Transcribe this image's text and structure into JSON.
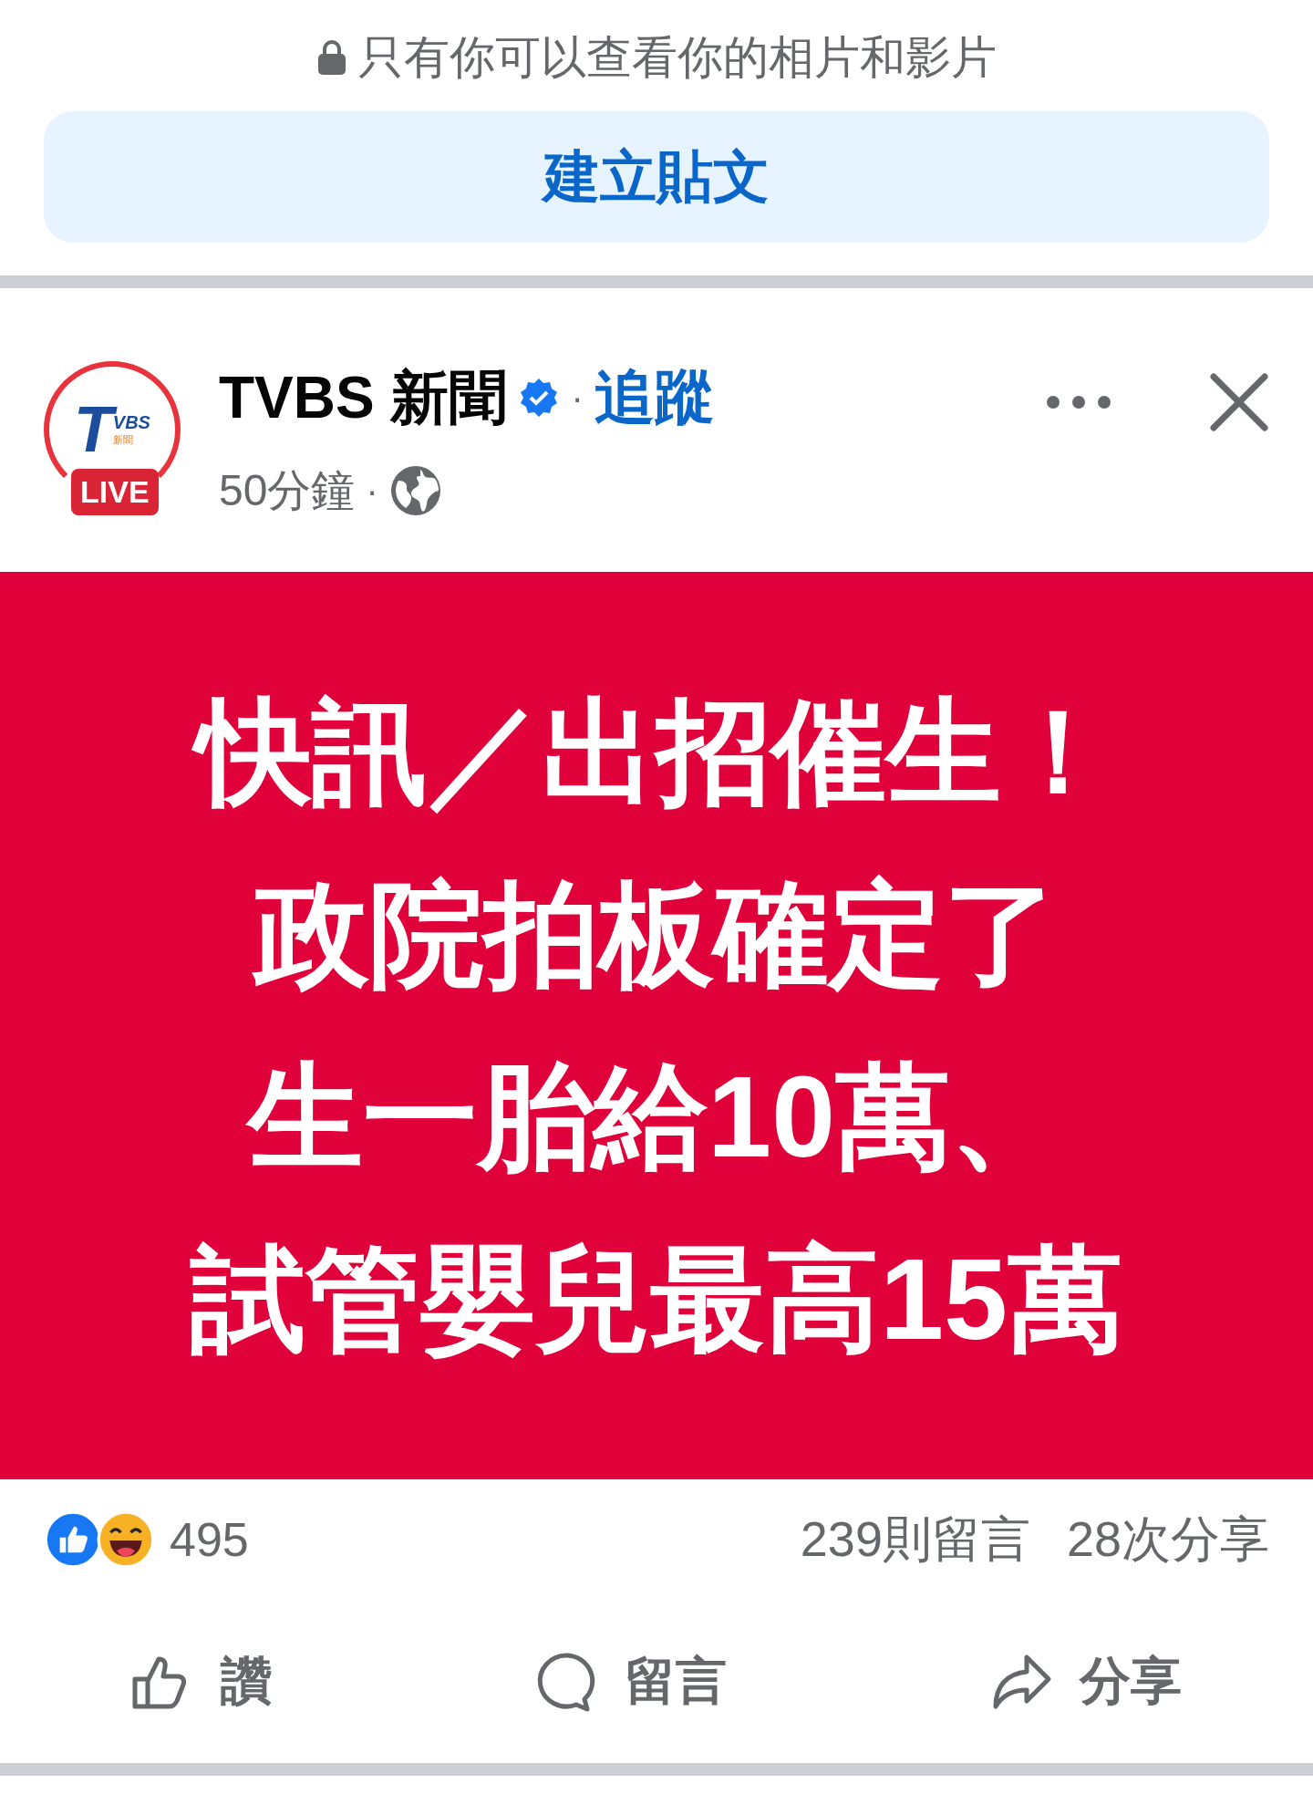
{
  "privacy_note": {
    "text": "只有你可以查看你的相片和影片"
  },
  "create_post_button": {
    "label": "建立貼文"
  },
  "post": {
    "avatar": {
      "logo_letter": "T",
      "logo_small": "VBS",
      "logo_cjk": "新聞",
      "badge": "LIVE"
    },
    "author": "TVBS 新聞",
    "verified": true,
    "separator": "·",
    "follow_link": "追蹤",
    "time": "50分鐘",
    "time_separator": "·",
    "image": {
      "kind": "news-card",
      "lines": [
        "快訊／出招催生！",
        "政院拍板確定了",
        "生一胎給10萬、",
        "試管嬰兒最高15萬"
      ]
    },
    "reactions": {
      "icons": [
        {
          "kind": "like"
        },
        {
          "kind": "haha"
        }
      ],
      "count": "495"
    },
    "comments": "239則留言",
    "shares": "28次分享",
    "actions": [
      {
        "kind": "like",
        "label": "讚"
      },
      {
        "kind": "comment",
        "label": "留言"
      },
      {
        "kind": "share",
        "label": "分享"
      }
    ]
  }
}
